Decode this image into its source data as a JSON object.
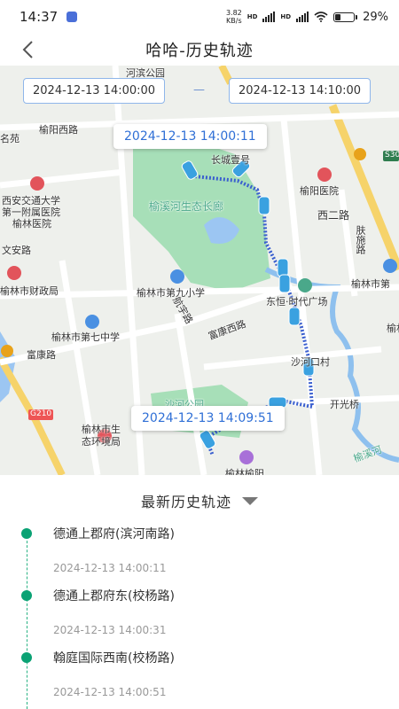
{
  "status": {
    "time": "14:37",
    "net_speed_top": "3.82",
    "net_speed_bottom": "KB/s",
    "net_type": "HD",
    "battery": "29%"
  },
  "header": {
    "title": "哈哈-历史轨迹",
    "back_icon": "chevron-left-icon"
  },
  "map": {
    "start_time": "2024-12-13 14:00:00",
    "separator": "—",
    "end_time": "2024-12-13 14:10:00",
    "track_start_label": "2024-12-13 14:00:11",
    "track_end_label": "2024-12-13 14:09:51",
    "places": [
      "河滨公园",
      "榆阳西路",
      "名苑",
      "长城壹号",
      "S304",
      "榆阳医院",
      "西安交通大学",
      "第一附属医院",
      "榆林医院",
      "西二路",
      "榆林市财政局",
      "文安路",
      "肤施路",
      "榆林市第九小学",
      "榆林市第",
      "东恒·时代广场",
      "航宇路",
      "富康西路",
      "榆林市第七中学",
      "富康路",
      "沙河口村",
      "榆林",
      "开光桥",
      "G210",
      "榆林市生",
      "态环境局",
      "沙河公园",
      "榆林榆阳",
      "榆溪河",
      "榆溪河生态长廊"
    ]
  },
  "history": {
    "title": "最新历史轨迹",
    "items": [
      {
        "name": "德通上郡府(滨河南路)",
        "time": "2024-12-13 14:00:11"
      },
      {
        "name": "德通上郡府东(校杨路)",
        "time": "2024-12-13 14:00:31"
      },
      {
        "name": "翰庭国际西南(校杨路)",
        "time": "2024-12-13 14:00:51"
      }
    ]
  },
  "colors": {
    "accent": "#2f6fd6",
    "timeline": "#0aa274",
    "park": "#a7dfb8",
    "water": "#9cc6f2",
    "road_major": "#f6d36a"
  }
}
